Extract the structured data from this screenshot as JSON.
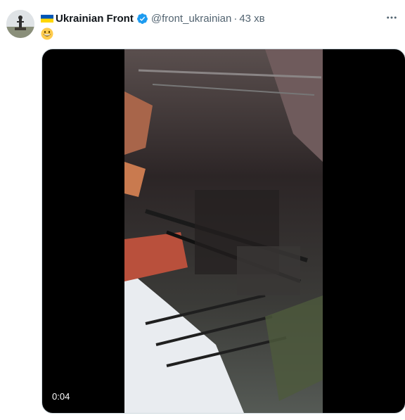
{
  "author": {
    "name": "Ukrainian Front",
    "handle": "@front_ukrainian",
    "separator": "·",
    "time": "43 хв",
    "avatar_icon": "avatar-image",
    "flag_icon": "ukraine-flag-icon",
    "verified_icon": "verified-badge-icon"
  },
  "tweet": {
    "text": "😁",
    "emoji_icon": "grinning-face-emoji-icon"
  },
  "video": {
    "duration": "0:04"
  },
  "colors": {
    "verified_blue": "#1d9bf0",
    "flag_blue": "#0057b7",
    "flag_yellow": "#ffd700",
    "secondary_text": "#536471"
  }
}
